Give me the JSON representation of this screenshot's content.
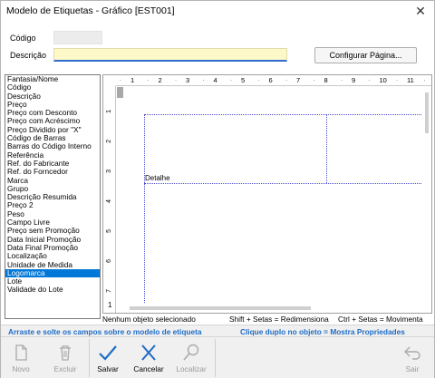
{
  "window": {
    "title": "Modelo de Etiquetas - Gráfico [EST001]",
    "close_glyph": "✕"
  },
  "form": {
    "codigo_label": "Código",
    "codigo_value": "",
    "descricao_label": "Descrição",
    "descricao_value": "",
    "configurar_button": "Configurar Página..."
  },
  "fields": {
    "items": [
      "Fantasia/Nome",
      "Código",
      "Descrição",
      "Preço",
      "Preço com Desconto",
      "Preço com Acréscimo",
      "Preço Dividido por \"X\"",
      "Código de Barras",
      "Barras do Código Interno",
      "Referência",
      "Ref. do Fabricante",
      "Ref. do Forncedor",
      "Marca",
      "Grupo",
      "Descrição Resumida",
      "Preço 2",
      "Peso",
      "Campo Livre",
      "Preço sem Promoção",
      "Data Inicial Promoção",
      "Data Final Promoção",
      "Localização",
      "Unidade de Medida",
      "Logomarca",
      "Lote",
      "Validade do Lote"
    ],
    "selected": "Logomarca"
  },
  "designer": {
    "ruler_h": [
      "1",
      "2",
      "3",
      "4",
      "5",
      "6",
      "7",
      "8",
      "9",
      "10",
      "11"
    ],
    "ruler_v": [
      "1",
      "2",
      "3",
      "4",
      "5",
      "6",
      "7"
    ],
    "band_label": "Detalhe",
    "page_number": "1"
  },
  "status": {
    "selection": "Nenhum objeto selecionado",
    "shift_hint": "Shift + Setas = Redimensiona",
    "ctrl_hint": "Ctrl + Setas = Movimenta"
  },
  "hints": {
    "drag": "Arraste e solte os campos sobre o modelo de etiqueta",
    "dblclick": "Clique duplo no objeto = Mostra Propriedades"
  },
  "toolbar": {
    "novo": "Novo",
    "excluir": "Excluir",
    "salvar": "Salvar",
    "cancelar": "Cancelar",
    "localizar": "Localizar",
    "sair": "Sair"
  },
  "colors": {
    "accent": "#1e6cc7",
    "selection": "#0078d7",
    "desc_bg": "#fdf8c8"
  }
}
